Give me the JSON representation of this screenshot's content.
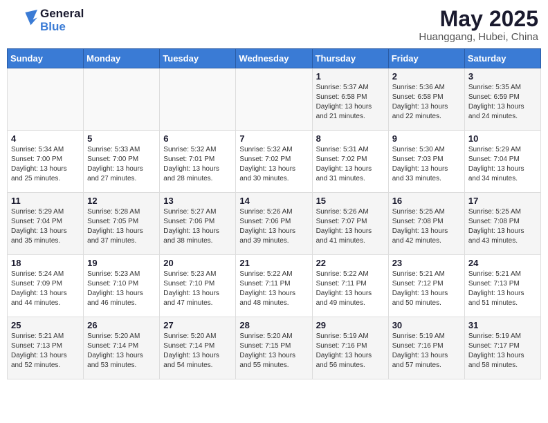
{
  "header": {
    "logo_general": "General",
    "logo_blue": "Blue",
    "title": "May 2025",
    "location": "Huanggang, Hubei, China"
  },
  "weekdays": [
    "Sunday",
    "Monday",
    "Tuesday",
    "Wednesday",
    "Thursday",
    "Friday",
    "Saturday"
  ],
  "weeks": [
    [
      {
        "day": "",
        "info": ""
      },
      {
        "day": "",
        "info": ""
      },
      {
        "day": "",
        "info": ""
      },
      {
        "day": "",
        "info": ""
      },
      {
        "day": "1",
        "info": "Sunrise: 5:37 AM\nSunset: 6:58 PM\nDaylight: 13 hours\nand 21 minutes."
      },
      {
        "day": "2",
        "info": "Sunrise: 5:36 AM\nSunset: 6:58 PM\nDaylight: 13 hours\nand 22 minutes."
      },
      {
        "day": "3",
        "info": "Sunrise: 5:35 AM\nSunset: 6:59 PM\nDaylight: 13 hours\nand 24 minutes."
      }
    ],
    [
      {
        "day": "4",
        "info": "Sunrise: 5:34 AM\nSunset: 7:00 PM\nDaylight: 13 hours\nand 25 minutes."
      },
      {
        "day": "5",
        "info": "Sunrise: 5:33 AM\nSunset: 7:00 PM\nDaylight: 13 hours\nand 27 minutes."
      },
      {
        "day": "6",
        "info": "Sunrise: 5:32 AM\nSunset: 7:01 PM\nDaylight: 13 hours\nand 28 minutes."
      },
      {
        "day": "7",
        "info": "Sunrise: 5:32 AM\nSunset: 7:02 PM\nDaylight: 13 hours\nand 30 minutes."
      },
      {
        "day": "8",
        "info": "Sunrise: 5:31 AM\nSunset: 7:02 PM\nDaylight: 13 hours\nand 31 minutes."
      },
      {
        "day": "9",
        "info": "Sunrise: 5:30 AM\nSunset: 7:03 PM\nDaylight: 13 hours\nand 33 minutes."
      },
      {
        "day": "10",
        "info": "Sunrise: 5:29 AM\nSunset: 7:04 PM\nDaylight: 13 hours\nand 34 minutes."
      }
    ],
    [
      {
        "day": "11",
        "info": "Sunrise: 5:29 AM\nSunset: 7:04 PM\nDaylight: 13 hours\nand 35 minutes."
      },
      {
        "day": "12",
        "info": "Sunrise: 5:28 AM\nSunset: 7:05 PM\nDaylight: 13 hours\nand 37 minutes."
      },
      {
        "day": "13",
        "info": "Sunrise: 5:27 AM\nSunset: 7:06 PM\nDaylight: 13 hours\nand 38 minutes."
      },
      {
        "day": "14",
        "info": "Sunrise: 5:26 AM\nSunset: 7:06 PM\nDaylight: 13 hours\nand 39 minutes."
      },
      {
        "day": "15",
        "info": "Sunrise: 5:26 AM\nSunset: 7:07 PM\nDaylight: 13 hours\nand 41 minutes."
      },
      {
        "day": "16",
        "info": "Sunrise: 5:25 AM\nSunset: 7:08 PM\nDaylight: 13 hours\nand 42 minutes."
      },
      {
        "day": "17",
        "info": "Sunrise: 5:25 AM\nSunset: 7:08 PM\nDaylight: 13 hours\nand 43 minutes."
      }
    ],
    [
      {
        "day": "18",
        "info": "Sunrise: 5:24 AM\nSunset: 7:09 PM\nDaylight: 13 hours\nand 44 minutes."
      },
      {
        "day": "19",
        "info": "Sunrise: 5:23 AM\nSunset: 7:10 PM\nDaylight: 13 hours\nand 46 minutes."
      },
      {
        "day": "20",
        "info": "Sunrise: 5:23 AM\nSunset: 7:10 PM\nDaylight: 13 hours\nand 47 minutes."
      },
      {
        "day": "21",
        "info": "Sunrise: 5:22 AM\nSunset: 7:11 PM\nDaylight: 13 hours\nand 48 minutes."
      },
      {
        "day": "22",
        "info": "Sunrise: 5:22 AM\nSunset: 7:11 PM\nDaylight: 13 hours\nand 49 minutes."
      },
      {
        "day": "23",
        "info": "Sunrise: 5:21 AM\nSunset: 7:12 PM\nDaylight: 13 hours\nand 50 minutes."
      },
      {
        "day": "24",
        "info": "Sunrise: 5:21 AM\nSunset: 7:13 PM\nDaylight: 13 hours\nand 51 minutes."
      }
    ],
    [
      {
        "day": "25",
        "info": "Sunrise: 5:21 AM\nSunset: 7:13 PM\nDaylight: 13 hours\nand 52 minutes."
      },
      {
        "day": "26",
        "info": "Sunrise: 5:20 AM\nSunset: 7:14 PM\nDaylight: 13 hours\nand 53 minutes."
      },
      {
        "day": "27",
        "info": "Sunrise: 5:20 AM\nSunset: 7:14 PM\nDaylight: 13 hours\nand 54 minutes."
      },
      {
        "day": "28",
        "info": "Sunrise: 5:20 AM\nSunset: 7:15 PM\nDaylight: 13 hours\nand 55 minutes."
      },
      {
        "day": "29",
        "info": "Sunrise: 5:19 AM\nSunset: 7:16 PM\nDaylight: 13 hours\nand 56 minutes."
      },
      {
        "day": "30",
        "info": "Sunrise: 5:19 AM\nSunset: 7:16 PM\nDaylight: 13 hours\nand 57 minutes."
      },
      {
        "day": "31",
        "info": "Sunrise: 5:19 AM\nSunset: 7:17 PM\nDaylight: 13 hours\nand 58 minutes."
      }
    ]
  ]
}
